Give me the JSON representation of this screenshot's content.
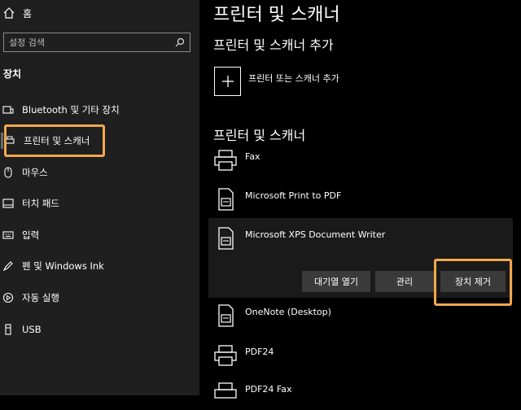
{
  "sidebar": {
    "home_label": "홈",
    "search_placeholder": "설정 검색",
    "section_title": "장치",
    "items": [
      {
        "label": "Bluetooth 및 기타 장치",
        "icon": "bluetooth-devices-icon"
      },
      {
        "label": "프린터 및 스캐너",
        "icon": "printer-icon",
        "selected": true
      },
      {
        "label": "마우스",
        "icon": "mouse-icon"
      },
      {
        "label": "터치 패드",
        "icon": "touchpad-icon"
      },
      {
        "label": "입력",
        "icon": "keyboard-icon"
      },
      {
        "label": "펜 및 Windows Ink",
        "icon": "pen-icon"
      },
      {
        "label": "자동 실행",
        "icon": "autoplay-icon"
      },
      {
        "label": "USB",
        "icon": "usb-icon"
      }
    ]
  },
  "main": {
    "title": "프린터 및 스캐너",
    "add_section_title": "프린터 및 스캐너 추가",
    "add_button_label": "프린터 또는 스캐너 추가",
    "list_section_title": "프린터 및 스캐너",
    "printers": [
      {
        "name": "Fax",
        "icon": "fax-icon"
      },
      {
        "name": "Microsoft Print to PDF",
        "icon": "pdf-printer-icon"
      },
      {
        "name": "Microsoft XPS Document Writer",
        "icon": "xps-printer-icon",
        "expanded": true
      },
      {
        "name": "OneNote (Desktop)",
        "icon": "onenote-printer-icon"
      },
      {
        "name": "PDF24",
        "icon": "printer-icon"
      },
      {
        "name": "PDF24 Fax",
        "icon": "fax-icon"
      }
    ],
    "actions": {
      "open_queue": "대기열 열기",
      "manage": "관리",
      "remove_device": "장치 제거"
    }
  },
  "colors": {
    "sidebar_bg": "#1f1f1f",
    "main_bg": "#000000",
    "highlight": "#f3a74b",
    "button_bg": "#3a3a3a"
  }
}
